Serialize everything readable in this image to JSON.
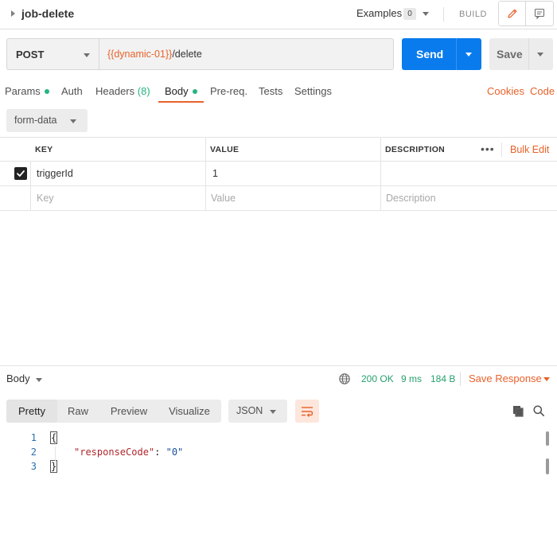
{
  "request": {
    "name": "job-delete",
    "examples_label": "Examples",
    "examples_count": "0",
    "build_label": "BUILD",
    "method": "POST",
    "url_var": "{{dynamic-01}}",
    "url_path": "/delete",
    "send_label": "Send",
    "save_label": "Save"
  },
  "tabs": {
    "params": "Params",
    "auth": "Auth",
    "headers": "Headers",
    "headers_count": "(8)",
    "body": "Body",
    "prereq": "Pre-req.",
    "tests": "Tests",
    "settings": "Settings",
    "cookies": "Cookies",
    "code": "Code"
  },
  "body": {
    "type": "form-data",
    "columns": {
      "key": "KEY",
      "value": "VALUE",
      "description": "DESCRIPTION"
    },
    "bulk_edit": "Bulk Edit",
    "more": "•••",
    "rows": [
      {
        "checked": true,
        "key": "triggerId",
        "value": "1",
        "description": ""
      }
    ],
    "placeholder": {
      "key": "Key",
      "value": "Value",
      "description": "Description"
    }
  },
  "response": {
    "title": "Body",
    "status": "200 OK",
    "time": "9 ms",
    "size": "184 B",
    "save_response": "Save Response",
    "view_tabs": [
      "Pretty",
      "Raw",
      "Preview",
      "Visualize"
    ],
    "active_view": "Pretty",
    "format": "JSON",
    "lines": [
      {
        "num": "1",
        "text": "{"
      },
      {
        "num": "2",
        "key": "\"responseCode\"",
        "sep": ": ",
        "val": "\"0\""
      },
      {
        "num": "3",
        "text": "}"
      }
    ]
  },
  "colors": {
    "accent": "#e8622a",
    "send": "#097bed",
    "success": "#26b47f"
  },
  "icons": {
    "title_caret": "caret-right-icon",
    "edit": "pencil-icon",
    "comments": "comment-icon",
    "globe": "globe-icon",
    "wrap": "wrap-lines-icon",
    "copy": "copy-icon",
    "search": "search-icon",
    "check": "checkbox-checked-icon"
  }
}
